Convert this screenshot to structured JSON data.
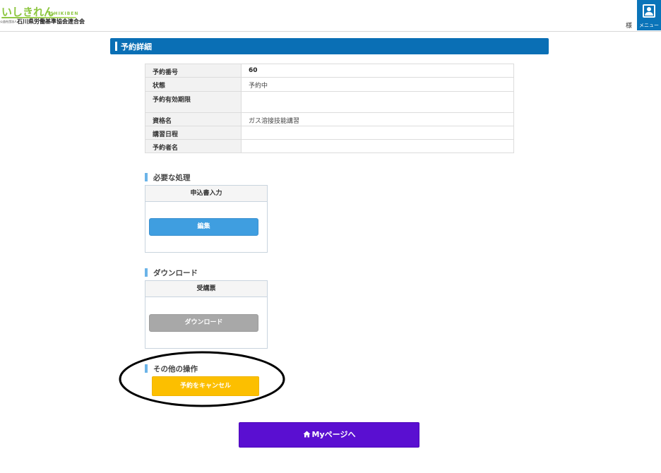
{
  "header": {
    "logo_main": "いしきれん",
    "logo_en": "ISHIKIBEN",
    "logo_prefix": "公益社団法人",
    "logo_sub": "石川県労働基準協会連合会",
    "user_suffix": "様",
    "menu_label": "メニュー"
  },
  "page_title": "予約詳細",
  "details": [
    {
      "label": "予約番号",
      "value": "60"
    },
    {
      "label": "状態",
      "value": "予約中"
    },
    {
      "label": "予約有効期限",
      "value": ""
    },
    {
      "label": "資格名",
      "value": "ガス溶接技能講習"
    },
    {
      "label": "講習日程",
      "value": ""
    },
    {
      "label": "予約者名",
      "value": ""
    }
  ],
  "required_section": {
    "heading": "必要な処理",
    "panel_title": "申込書入力",
    "button": "編集"
  },
  "download_section": {
    "heading": "ダウンロード",
    "panel_title": "受講票",
    "button": "ダウンロード"
  },
  "other_section": {
    "heading": "その他の操作",
    "button": "予約をキャンセル"
  },
  "mypage_button": "Myページへ",
  "colors": {
    "brand_blue": "#0a6fb5",
    "accent_green": "#8cc63f",
    "edit_blue": "#3f9ee0",
    "cancel_yellow": "#fcbf00",
    "mypage_purple": "#5a0fd1"
  },
  "icons": [
    "user-icon",
    "home-icon"
  ]
}
